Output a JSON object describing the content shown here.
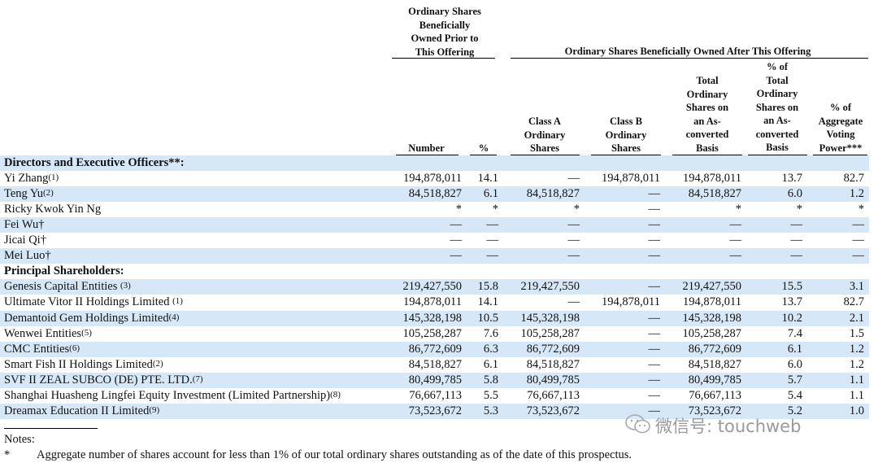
{
  "headers": {
    "prior_group": "Ordinary Shares\nBeneficially\nOwned Prior to\nThis Offering",
    "after_group": "Ordinary Shares Beneficially Owned After This Offering",
    "number": "Number",
    "pct": "%",
    "class_a": "Class A\nOrdinary\nShares",
    "class_b": "Class B\nOrdinary\nShares",
    "total_converted": "Total\nOrdinary\nShares on\nan As-\nconverted\nBasis",
    "pct_total": "% of\nTotal\nOrdinary\nShares on\nan As-\nconverted\nBasis",
    "pct_voting": "% of\nAggregate\nVoting\nPower***"
  },
  "rows": [
    {
      "name": "Directors and Executive Officers**:",
      "section": true
    },
    {
      "name": "Yi Zhang",
      "ref": "(1)",
      "number": "194,878,011",
      "pct": "14.1",
      "class_a": "—",
      "class_b": "194,878,011",
      "total": "194,878,011",
      "pct_total": "13.7",
      "voting": "82.7"
    },
    {
      "name": "Teng Yu",
      "ref": "(2)",
      "number": "84,518,827",
      "pct": "6.1",
      "class_a": "84,518,827",
      "class_b": "—",
      "total": "84,518,827",
      "pct_total": "6.0",
      "voting": "1.2"
    },
    {
      "name": "Ricky Kwok Yin Ng",
      "ref": "",
      "number": "*",
      "pct": "*",
      "class_a": "*",
      "class_b": "—",
      "total": "*",
      "pct_total": "*",
      "voting": "*"
    },
    {
      "name": "Fei Wu†",
      "ref": "",
      "number": "—",
      "pct": "—",
      "class_a": "—",
      "class_b": "—",
      "total": "—",
      "pct_total": "—",
      "voting": "—"
    },
    {
      "name": "Jicai Qi†",
      "ref": "",
      "number": "—",
      "pct": "—",
      "class_a": "—",
      "class_b": "—",
      "total": "—",
      "pct_total": "—",
      "voting": "—"
    },
    {
      "name": "Mei Luo†",
      "ref": "",
      "number": "—",
      "pct": "—",
      "class_a": "—",
      "class_b": "—",
      "total": "—",
      "pct_total": "—",
      "voting": "—"
    },
    {
      "name": "Principal Shareholders:",
      "section": true
    },
    {
      "name": "Genesis Capital Entities ",
      "ref": "(3)",
      "number": "219,427,550",
      "pct": "15.8",
      "class_a": "219,427,550",
      "class_b": "—",
      "total": "219,427,550",
      "pct_total": "15.5",
      "voting": "3.1"
    },
    {
      "name": "Ultimate Vitor II Holdings Limited ",
      "ref": "(1)",
      "number": "194,878,011",
      "pct": "14.1",
      "class_a": "—",
      "class_b": "194,878,011",
      "total": "194,878,011",
      "pct_total": "13.7",
      "voting": "82.7"
    },
    {
      "name": "Demantoid Gem Holdings Limited",
      "ref": "(4)",
      "number": "145,328,198",
      "pct": "10.5",
      "class_a": "145,328,198",
      "class_b": "—",
      "total": "145,328,198",
      "pct_total": "10.2",
      "voting": "2.1"
    },
    {
      "name": "Wenwei Entities",
      "ref": "(5)",
      "number": "105,258,287",
      "pct": "7.6",
      "class_a": "105,258,287",
      "class_b": "—",
      "total": "105,258,287",
      "pct_total": "7.4",
      "voting": "1.5"
    },
    {
      "name": "CMC Entities",
      "ref": "(6)",
      "number": "86,772,609",
      "pct": "6.3",
      "class_a": "86,772,609",
      "class_b": "—",
      "total": "86,772,609",
      "pct_total": "6.1",
      "voting": "1.2"
    },
    {
      "name": "Smart Fish II Holdings Limited",
      "ref": "(2)",
      "number": "84,518,827",
      "pct": "6.1",
      "class_a": "84,518,827",
      "class_b": "—",
      "total": "84,518,827",
      "pct_total": "6.0",
      "voting": "1.2"
    },
    {
      "name": "SVF II ZEAL SUBCO (DE) PTE. LTD.",
      "ref": "(7)",
      "number": "80,499,785",
      "pct": "5.8",
      "class_a": "80,499,785",
      "class_b": "—",
      "total": "80,499,785",
      "pct_total": "5.7",
      "voting": "1.1"
    },
    {
      "name": "Shanghai Huasheng Lingfei Equity Investment (Limited Partnership)",
      "ref": "(8)",
      "number": "76,667,113",
      "pct": "5.5",
      "class_a": "76,667,113",
      "class_b": "—",
      "total": "76,667,113",
      "pct_total": "5.4",
      "voting": "1.1"
    },
    {
      "name": "Dreamax Education II Limited",
      "ref": "(9)",
      "number": "73,523,672",
      "pct": "5.3",
      "class_a": "73,523,672",
      "class_b": "—",
      "total": "73,523,672",
      "pct_total": "5.2",
      "voting": "1.0"
    }
  ],
  "notes": {
    "title": "Notes:",
    "items": [
      {
        "mark": "*",
        "text": "Aggregate number of shares account for less than 1% of our total ordinary shares outstanding as of the date of this prospectus."
      }
    ]
  },
  "watermark": {
    "text": "微信号: touchweb",
    "icon": "wechat-icon",
    "color": "#9a9a9a"
  },
  "colors": {
    "band": "#d6e8f7",
    "text": "#111111"
  }
}
